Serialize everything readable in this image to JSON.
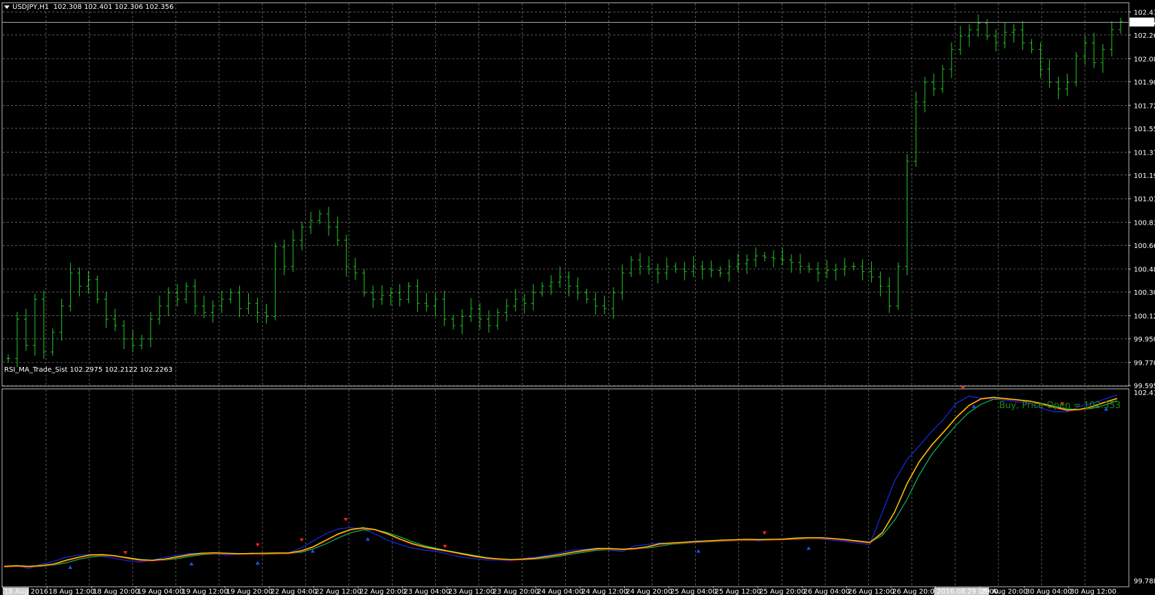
{
  "window": {
    "symbol_label": "USDJPY,H1",
    "ohlc": "102.308 102.401 102.306 102.356"
  },
  "indicator": {
    "label": "RSI_MA_Trade_Sist",
    "values": "102.2975 102.2122 102.2263",
    "signal_text": "Buy, Price Open = 102.353"
  },
  "colors": {
    "background": "#000000",
    "grid": "#9a9a9a",
    "bars": "#22cc22",
    "line_blue": "#1428e0",
    "line_yellow": "#e6e600",
    "line_red": "#e01010",
    "line_green": "#10b050",
    "arrow_down": "#ff2020",
    "arrow_up": "#2050ff",
    "price_line": "#aaaaaa"
  },
  "chart_data": [
    {
      "type": "ohlc",
      "title": "USDJPY,H1",
      "ylim": [
        99.595,
        102.5
      ],
      "y_ticks": [
        "102.435",
        "102.260",
        "102.080",
        "101.905",
        "101.725",
        "101.550",
        "101.370",
        "101.195",
        "101.015",
        "100.835",
        "100.660",
        "100.480",
        "100.305",
        "100.125",
        "99.950",
        "99.770",
        "99.595"
      ],
      "current_price": "102.356",
      "closes": [
        99.8,
        100.1,
        99.9,
        100.25,
        99.85,
        100.0,
        100.2,
        100.45,
        100.35,
        100.4,
        100.25,
        100.1,
        100.05,
        99.95,
        99.9,
        99.95,
        100.1,
        100.2,
        100.3,
        100.25,
        100.35,
        100.2,
        100.15,
        100.2,
        100.25,
        100.3,
        100.18,
        100.22,
        100.15,
        100.12,
        100.65,
        100.5,
        100.7,
        100.8,
        100.85,
        100.9,
        100.8,
        100.7,
        100.5,
        100.45,
        100.3,
        100.25,
        100.28,
        100.3,
        100.25,
        100.35,
        100.22,
        100.2,
        100.25,
        100.1,
        100.05,
        100.12,
        100.18,
        100.1,
        100.05,
        100.15,
        100.2,
        100.25,
        100.22,
        100.3,
        100.35,
        100.38,
        100.42,
        100.35,
        100.3,
        100.25,
        100.2,
        100.18,
        100.3,
        100.45,
        100.55,
        100.5,
        100.48,
        100.45,
        100.5,
        100.48,
        100.46,
        100.5,
        100.48,
        100.47,
        100.45,
        100.5,
        100.52,
        100.55,
        100.58,
        100.57,
        100.56,
        100.55,
        100.53,
        100.5,
        100.48,
        100.45,
        100.47,
        100.48,
        100.5,
        100.5,
        100.46,
        100.42,
        100.35,
        100.2,
        100.5,
        101.3,
        101.75,
        101.9,
        101.85,
        102.0,
        102.15,
        102.25,
        102.3,
        102.35,
        102.25,
        102.2,
        102.28,
        102.3,
        102.2,
        102.15,
        102.0,
        101.9,
        101.85,
        101.9,
        102.1,
        102.2,
        102.05,
        102.15,
        102.3,
        102.36
      ],
      "x_tick_labels": [
        "18 Aug 2016",
        "18 Aug 12:00",
        "18 Aug 20:00",
        "19 Aug 04:00",
        "19 Aug 12:00",
        "19 Aug 20:00",
        "22 Aug 04:00",
        "22 Aug 12:00",
        "22 Aug 20:00",
        "23 Aug 04:00",
        "23 Aug 12:00",
        "23 Aug 20:00",
        "24 Aug 04:00",
        "24 Aug 12:00",
        "24 Aug 20:00",
        "25 Aug 04:00",
        "25 Aug 12:00",
        "25 Aug 20:00",
        "26 Aug 04:00",
        "26 Aug 12:00",
        "26 Aug 20:00",
        "2016.08.29 05:00",
        "29 Aug 20:00",
        "30 Aug 04:00",
        "30 Aug 12:00"
      ]
    },
    {
      "type": "line",
      "title": "RSI_MA_Trade_Sist",
      "ylim": [
        99.7887,
        102.417
      ],
      "y_ticks": [
        "102.417",
        "99.7887"
      ],
      "series": [
        {
          "values": [
            99.98,
            100.0,
            99.96,
            100.02,
            100.06,
            100.12,
            100.15,
            100.16,
            100.13,
            100.1,
            100.07,
            100.05,
            100.08,
            100.12,
            100.15,
            100.17,
            100.18,
            100.17,
            100.15,
            100.16,
            100.18,
            100.16,
            100.17,
            100.18,
            100.25,
            100.35,
            100.45,
            100.52,
            100.54,
            100.52,
            100.45,
            100.36,
            100.3,
            100.25,
            100.22,
            100.2,
            100.16,
            100.12,
            100.1,
            100.08,
            100.08,
            100.07,
            100.1,
            100.12,
            100.15,
            100.18,
            100.22,
            100.23,
            100.25,
            100.22,
            100.2,
            100.28,
            100.3,
            100.32,
            100.32,
            100.33,
            100.35,
            100.35,
            100.36,
            100.36,
            100.37,
            100.35,
            100.37,
            100.38,
            100.39,
            100.39,
            100.38,
            100.36,
            100.34,
            100.32,
            100.3,
            100.75,
            101.2,
            101.5,
            101.7,
            101.9,
            102.08,
            102.3,
            102.4,
            102.37,
            102.36,
            102.34,
            102.32,
            102.3,
            102.22,
            102.18,
            102.18,
            102.26,
            102.3,
            102.36,
            102.42
          ]
        }
      ],
      "arrows_down": 8,
      "arrows_up": 9
    }
  ]
}
